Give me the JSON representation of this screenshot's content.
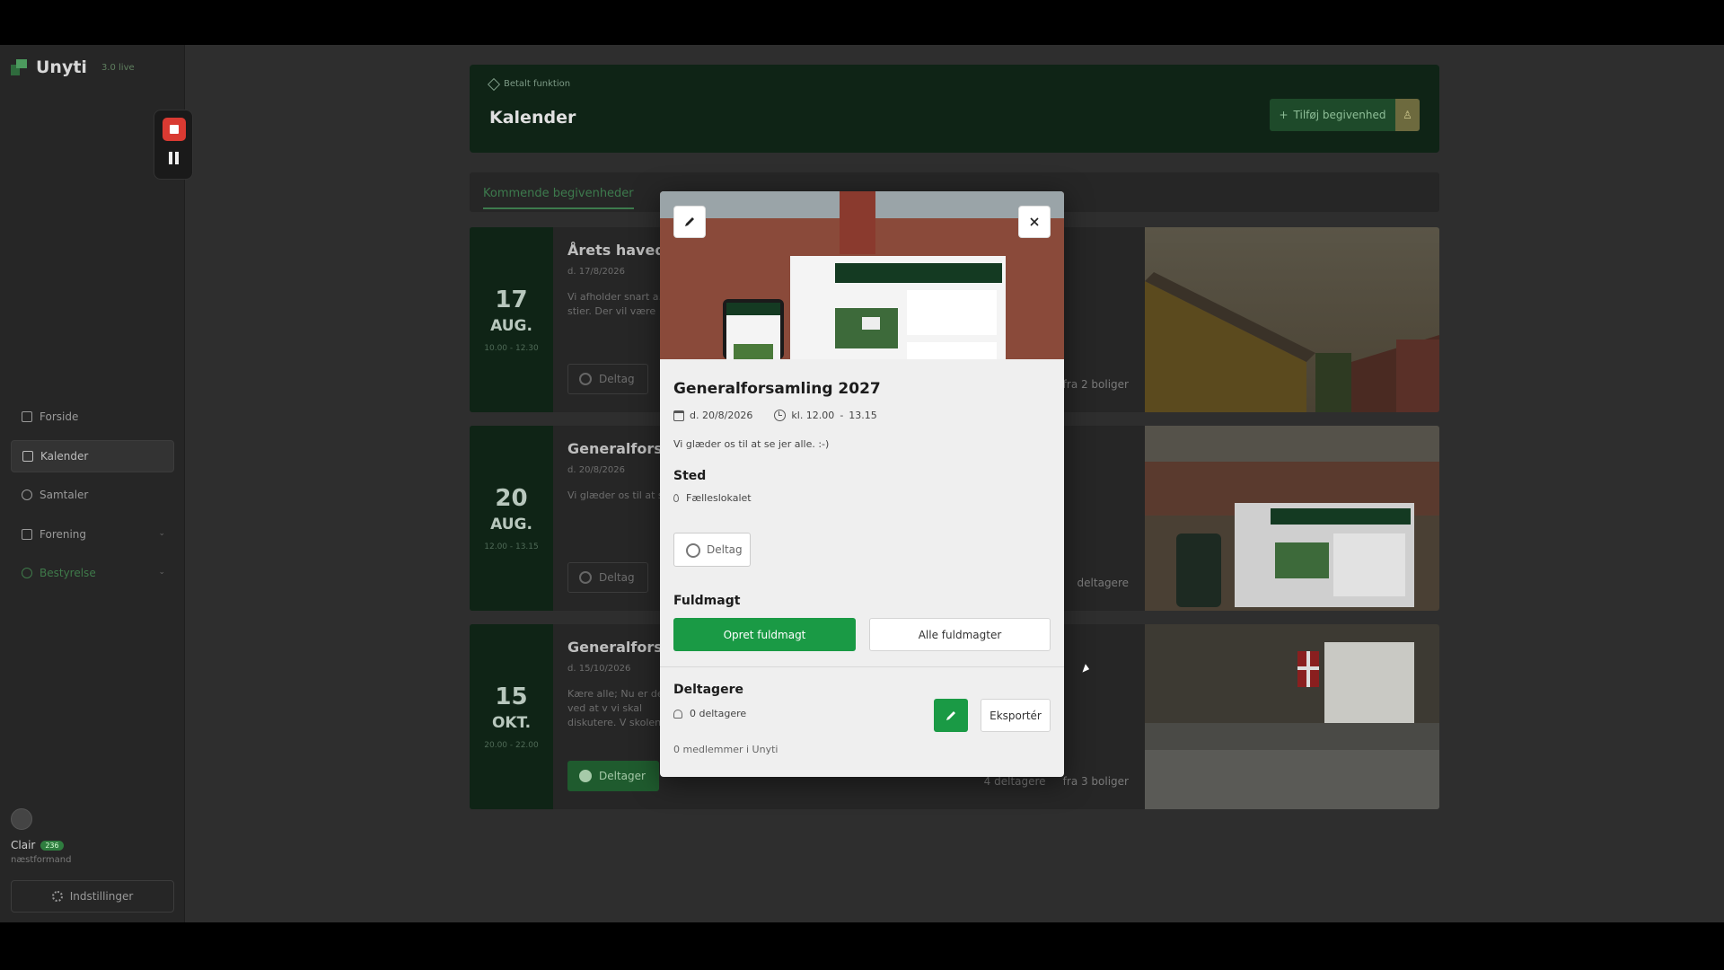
{
  "app": {
    "name": "Unyti",
    "version": "3.0 live"
  },
  "sidebar": {
    "items": [
      {
        "label": "Forside",
        "icon": "document-icon"
      },
      {
        "label": "Kalender",
        "icon": "calendar-icon",
        "active": true
      },
      {
        "label": "Samtaler",
        "icon": "chat-icon"
      },
      {
        "label": "Forening",
        "icon": "building-icon",
        "has_submenu": true
      },
      {
        "label": "Bestyrelse",
        "icon": "user-icon",
        "has_submenu": true,
        "highlight": true
      }
    ],
    "user": {
      "name": "Clair",
      "badge": "236",
      "role": "næstformand"
    },
    "settings_label": "Indstillinger"
  },
  "header": {
    "tag": "Betalt funktion",
    "title": "Kalender",
    "add_button": "Tilføj begivenhed"
  },
  "tabs": {
    "active": "Kommende begivenheder"
  },
  "events": [
    {
      "day": "17",
      "month": "AUG.",
      "time": "10.00 - 12.30",
      "title": "Årets havedag",
      "date": "d. 17/8/2026",
      "description": "Vi afholder snart a… stier. Der vil være",
      "button": "Deltag",
      "joined": false,
      "stats": "fra 2 boliger"
    },
    {
      "day": "20",
      "month": "AUG.",
      "time": "12.00 - 13.15",
      "title": "Generalforsa",
      "date": "d. 20/8/2026",
      "description": "Vi glæder os til at s",
      "button": "Deltag",
      "joined": false,
      "stats": "deltagere"
    },
    {
      "day": "15",
      "month": "OKT.",
      "time": "20.00 - 22.00",
      "title": "Generalforsar",
      "date": "d. 15/10/2026",
      "description": "Kære alle; Nu er det ved at v vi skal diskutere. V skolen.",
      "button": "Deltager",
      "joined": true,
      "stats_participants": "4 deltagere",
      "stats": "fra 3 boliger"
    }
  ],
  "modal": {
    "title": "Generalforsamling 2027",
    "date": "d. 20/8/2026",
    "time_start": "kl. 12.00",
    "time_sep": "-",
    "time_end": "13.15",
    "description": "Vi glæder os til at se jer alle. :-)",
    "location_heading": "Sted",
    "location": "Fælleslokalet",
    "join_button": "Deltag",
    "proxy_heading": "Fuldmagt",
    "create_proxy": "Opret fuldmagt",
    "all_proxies": "Alle fuldmagter",
    "participants_heading": "Deltagere",
    "participants_count": "0 deltagere",
    "export_button": "Eksportér",
    "members_note": "0 medlemmer i Unyti"
  }
}
